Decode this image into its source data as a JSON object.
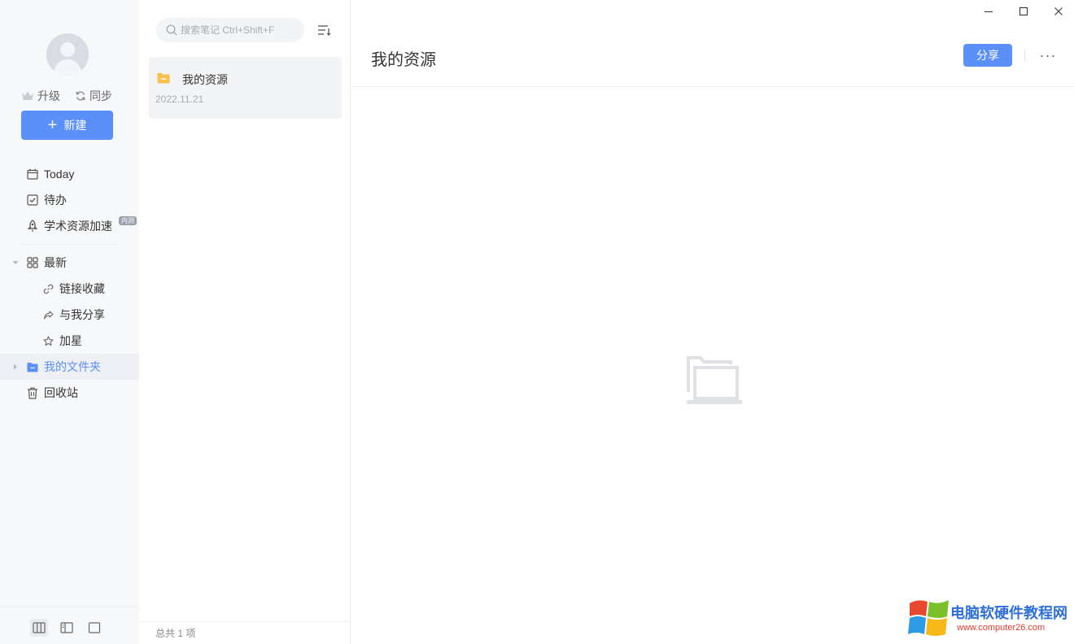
{
  "sidebar": {
    "upgrade_label": "升级",
    "sync_label": "同步",
    "new_label": "新建",
    "nav": {
      "today": "Today",
      "todo": "待办",
      "academic": "学术资源加速",
      "beta_badge": "内测",
      "latest": "最新",
      "links": "链接收藏",
      "shared": "与我分享",
      "starred": "加星",
      "my_folder": "我的文件夹",
      "trash": "回收站"
    }
  },
  "list": {
    "search_placeholder": "搜索笔记 Ctrl+Shift+F",
    "items": [
      {
        "title": "我的资源",
        "date": "2022.11.21"
      }
    ],
    "footer": "总共 1 项"
  },
  "content": {
    "title": "我的资源",
    "share_label": "分享",
    "more_label": "···"
  },
  "watermark": {
    "title": "电脑软硬件教程网",
    "url": "www.computer26.com"
  },
  "colors": {
    "accent": "#5b8ff9",
    "folder": "#f8c14e",
    "sidebar_bg": "#f7f8fa"
  }
}
